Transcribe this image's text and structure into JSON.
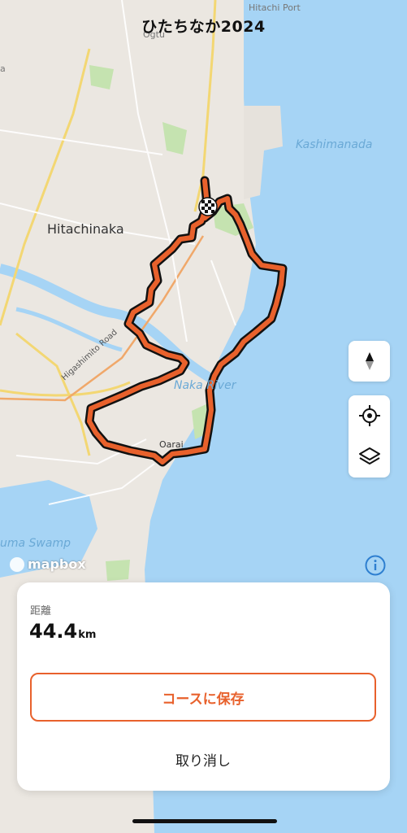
{
  "header": {
    "title": "ひたちなか2024"
  },
  "map": {
    "labels": {
      "hitachi_port": "Hitachi Port",
      "kashimanada": "Kashimanada",
      "hitachinaka": "Hitachinaka",
      "higashimito_road": "Higashimito Road",
      "naka_river": "Naka River",
      "oarai": "Oarai",
      "swamp": "uma Swamp",
      "top_fragment": "a",
      "top_fragment2": "Ogtu"
    },
    "attribution": "mapbox",
    "colors": {
      "route": "#e8612c",
      "sea": "#a6d4f5",
      "land": "#ebe7e1",
      "park": "#c5e3b0"
    }
  },
  "controls": {
    "compass": "compass-icon",
    "locate": "locate-icon",
    "layers": "layers-icon",
    "info": "info-icon"
  },
  "sheet": {
    "distance_label": "距離",
    "distance_value": "44.4",
    "distance_unit": "km",
    "save_label": "コースに保存",
    "cancel_label": "取り消し"
  }
}
